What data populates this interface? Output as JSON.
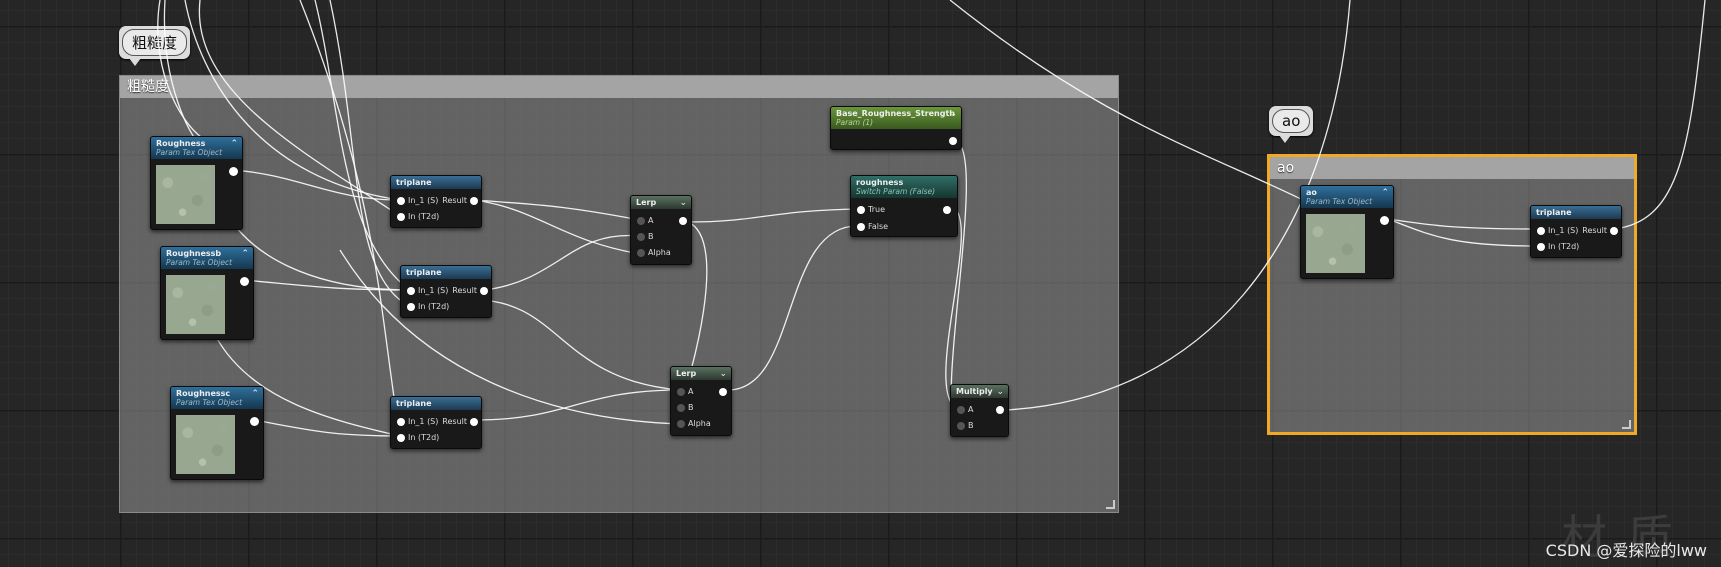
{
  "comments": {
    "roughness": {
      "bubble": "粗糙度",
      "header": "粗糙度"
    },
    "ao": {
      "bubble": "ao",
      "header": "ao"
    }
  },
  "nodes": {
    "roughness_tex": {
      "title": "Roughness",
      "subtitle": "Param Tex Object"
    },
    "roughnessb_tex": {
      "title": "Roughnessb",
      "subtitle": "Param Tex Object"
    },
    "roughnessc_tex": {
      "title": "Roughnessc",
      "subtitle": "Param Tex Object"
    },
    "triplane1": {
      "title": "triplane",
      "pin_in1": "In_1 (S)",
      "pin_in2": "In (T2d)",
      "result": "Result"
    },
    "triplane2": {
      "title": "triplane",
      "pin_in1": "In_1 (S)",
      "pin_in2": "In (T2d)",
      "result": "Result"
    },
    "triplane3": {
      "title": "triplane",
      "pin_in1": "In_1 (S)",
      "pin_in2": "In (T2d)",
      "result": "Result"
    },
    "lerp1": {
      "title": "Lerp",
      "pin_a": "A",
      "pin_b": "B",
      "pin_alpha": "Alpha"
    },
    "lerp2": {
      "title": "Lerp",
      "pin_a": "A",
      "pin_b": "B",
      "pin_alpha": "Alpha"
    },
    "base_strength": {
      "title": "Base_Roughness_Strength",
      "subtitle": "Param (1)"
    },
    "switch": {
      "title": "roughness",
      "subtitle": "Switch Param (False)",
      "pin_true": "True",
      "pin_false": "False"
    },
    "multiply": {
      "title": "Multiply",
      "pin_a": "A",
      "pin_b": "B"
    },
    "ao_tex": {
      "title": "ao",
      "subtitle": "Param Tex Object"
    },
    "triplane_ao": {
      "title": "triplane",
      "pin_in1": "In_1 (S)",
      "pin_in2": "In (T2d)",
      "result": "Result"
    }
  },
  "watermark": "CSDN @爱探险的lww",
  "background_glyphs": "材质",
  "colors": {
    "selection": "#f0a825",
    "wire": "#ffffff",
    "param_header": "#2f6f9c",
    "scalar_header": "#69963a"
  }
}
